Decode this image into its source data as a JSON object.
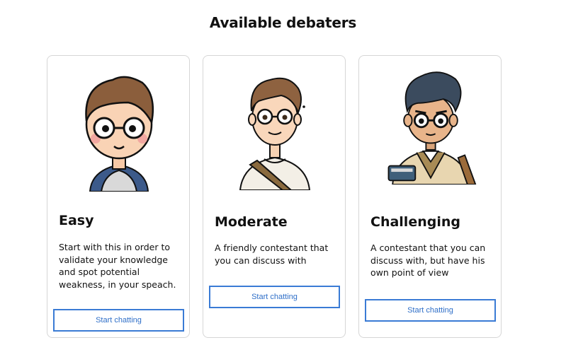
{
  "header": {
    "title": "Available debaters"
  },
  "cards": [
    {
      "title": "Easy",
      "description": "Start with this in order to validate your knowledge and spot potential weakness, in your speach.",
      "button_label": "Start chatting"
    },
    {
      "title": "Moderate",
      "description": "A friendly contestant that you can discuss with",
      "button_label": "Start chatting"
    },
    {
      "title": "Challenging",
      "description": "A contestant that you can discuss with, but have his own point of view",
      "button_label": "Start chatting"
    }
  ],
  "colors": {
    "button_border": "#3a7bd5",
    "button_text": "#2f6fc8",
    "card_border": "#d6d6d6"
  }
}
